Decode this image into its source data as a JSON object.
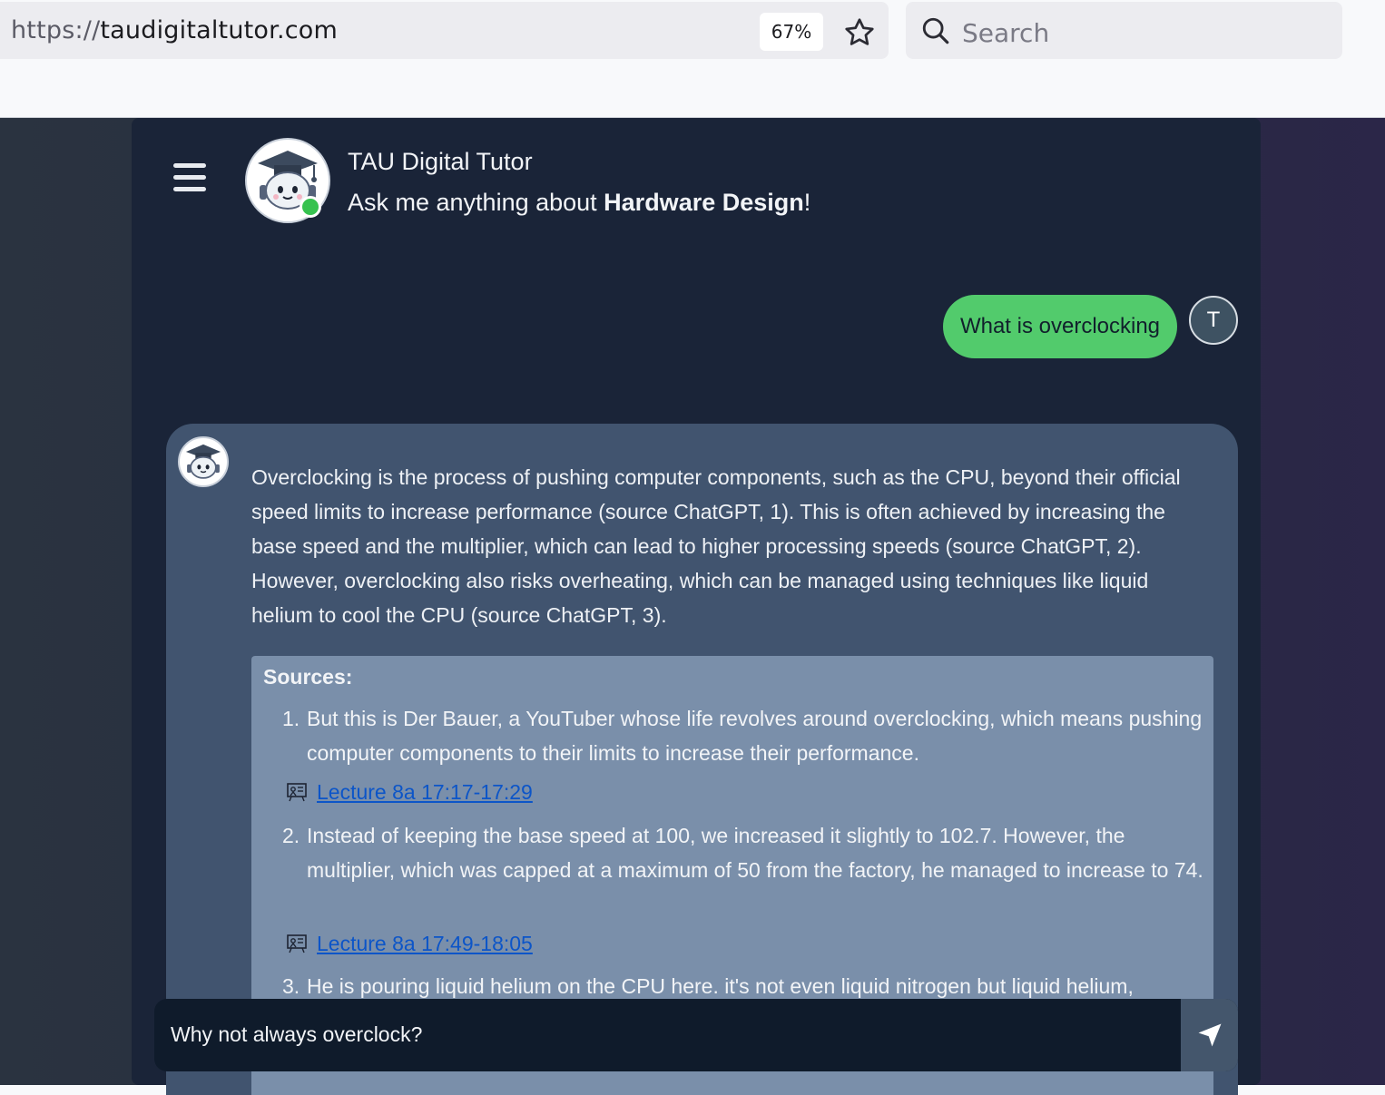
{
  "browser": {
    "url_scheme": "https://",
    "url_host": "taudigitaltutor.com",
    "zoom": "67%",
    "search_placeholder": "Search"
  },
  "header": {
    "title": "TAU Digital Tutor",
    "subtitle_prefix": "Ask me anything about ",
    "subtitle_topic": "Hardware Design",
    "subtitle_suffix": "!"
  },
  "chat": {
    "user_message": "What is overclocking",
    "user_initial": "T",
    "answer": "Overclocking is the process of pushing computer components, such as the CPU, beyond their official speed limits to increase performance (source ChatGPT, 1). This is often achieved by increasing the base speed and the multiplier, which can lead to higher processing speeds (source ChatGPT, 2). However, overclocking also risks overheating, which can be managed using techniques like liquid helium to cool the CPU (source ChatGPT, 3).",
    "sources_title": "Sources:",
    "sources": [
      {
        "num": "1.",
        "text": "But this is Der Bauer, a YouTuber whose life revolves around overclocking, which means pushing computer components to their limits to increase their performance.",
        "link": "Lecture 8a 17:17-17:29"
      },
      {
        "num": "2.",
        "text": "Instead of keeping the base speed at 100, we increased it slightly to 102.7. However, the multiplier, which was capped at a maximum of 50 from the factory, he managed to increase to 74.",
        "link": "Lecture 8a 17:49-18:05"
      },
      {
        "num": "3.",
        "text": "He is pouring liquid helium on the CPU here. it's not even liquid nitrogen but liquid helium,",
        "link": ""
      }
    ]
  },
  "input": {
    "value": "Why not always overclock?"
  },
  "colors": {
    "user_bubble": "#52cb6c",
    "panel": "#1a2438",
    "bot_card": "#41546f",
    "sources_box": "#7a8faa",
    "link": "#0c55c8"
  }
}
